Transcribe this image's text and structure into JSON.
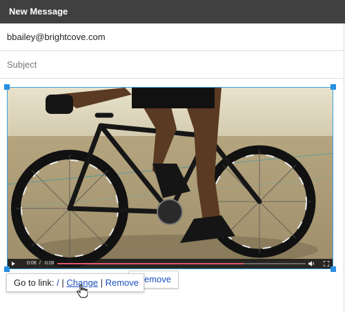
{
  "window": {
    "title": "New Message"
  },
  "compose": {
    "to_value": "bbailey@brightcove.com",
    "subject_placeholder": "Subject"
  },
  "video": {
    "time_current": "0:06",
    "time_separator": "/",
    "time_total": "0:08",
    "progress": 0.75,
    "progress_color": "#e05870",
    "selection_color": "#2a8fe0",
    "icons": [
      "play-icon",
      "volume-icon",
      "fullscreen-icon"
    ]
  },
  "link_popup": {
    "go_to_label": "Go to link:",
    "link_text": "/",
    "separator": "|",
    "change_label": "Change",
    "remove_label": "Remove",
    "behind_remove_label": "Remove",
    "link_color": "#1a4fc0"
  }
}
